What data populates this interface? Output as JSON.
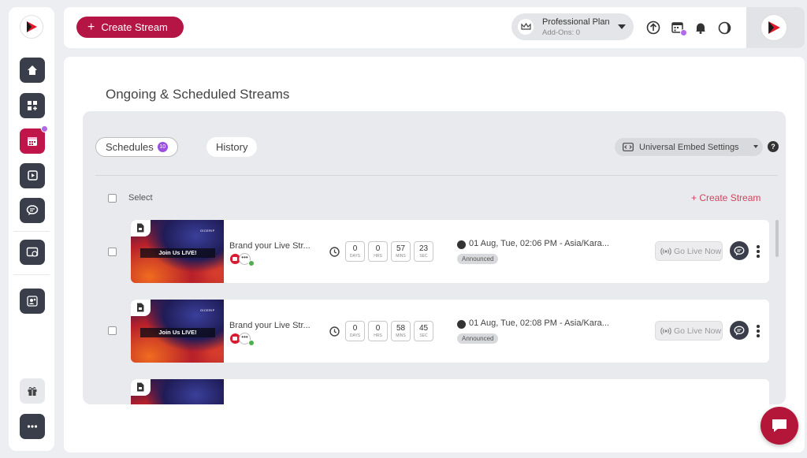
{
  "topbar": {
    "create_stream_label": "Create Stream",
    "plan_name": "Professional Plan",
    "addons": "Add-Ons: 0"
  },
  "page": {
    "title": "Ongoing & Scheduled Streams"
  },
  "tabs": {
    "schedules_label": "Schedules",
    "schedules_count": "10",
    "history_label": "History"
  },
  "embed_settings_label": "Universal Embed Settings",
  "help_label": "?",
  "select_label": "Select",
  "create_stream_link": "+ Create Stream",
  "countdown_units": [
    "DAYS",
    "HRS",
    "MINS",
    "SEC"
  ],
  "streams": [
    {
      "thumb_text": "Join Us LIVE!",
      "thumb_tag": "OICERIP",
      "title": "Brand your Live Str...",
      "countdown": [
        "0",
        "0",
        "57",
        "23"
      ],
      "schedule": "01 Aug, Tue, 02:06 PM - Asia/Kara...",
      "status": "Announced",
      "go_live_label": "Go Live Now"
    },
    {
      "thumb_text": "Join Us LIVE!",
      "thumb_tag": "OICERIP",
      "title": "Brand your Live Str...",
      "countdown": [
        "0",
        "0",
        "58",
        "45"
      ],
      "schedule": "01 Aug, Tue, 02:08 PM - Asia/Kara...",
      "status": "Announced",
      "go_live_label": "Go Live Now"
    }
  ],
  "colors": {
    "brand": "#b41544",
    "accent_purple": "#9a4fe0",
    "dark": "#3a3e4a"
  }
}
